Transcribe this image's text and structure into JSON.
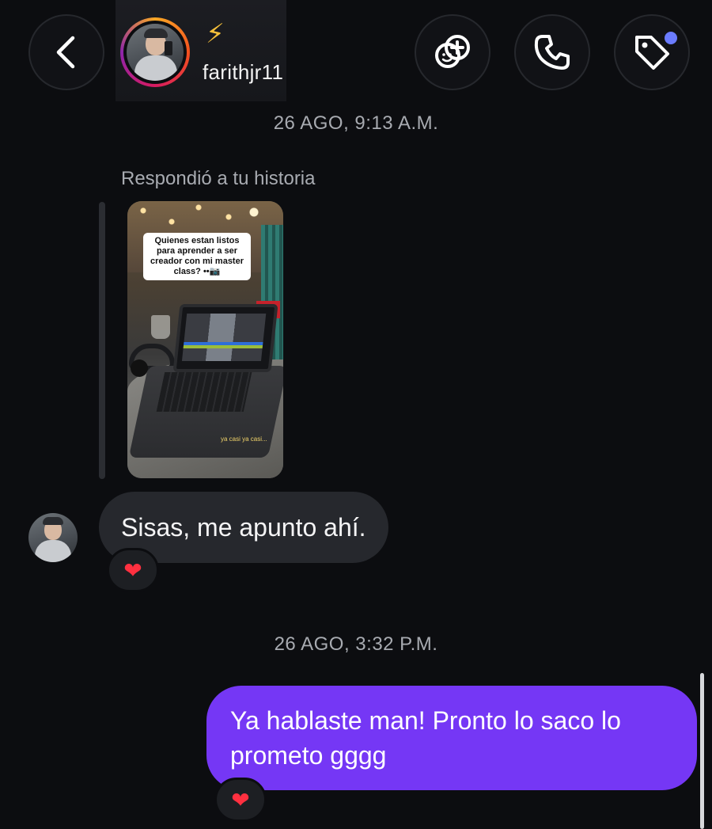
{
  "header": {
    "username": "farithjr11",
    "status_icon": "lightning-bolt-icon",
    "status_glyph": "⚡",
    "buttons": {
      "back": "chevron-left-icon",
      "effects": "sticker-add-icon",
      "call": "phone-icon",
      "tag": "tag-icon"
    },
    "tag_notification_color": "#6b7cff"
  },
  "messages": {
    "timestamp_1": "26 AGO, 9:13 A.M.",
    "story_reply_label": "Respondió a tu historia",
    "story": {
      "caption": "Quienes estan listos para aprender a ser creador con mi master class? ••📷",
      "sign_number": "30",
      "footer_text": "ya casi ya casi..."
    },
    "incoming_text": "Sisas, me apunto ahí.",
    "incoming_reaction": "❤",
    "timestamp_2": "26 AGO, 3:32 P.M.",
    "outgoing_text": "Ya hablaste man! Pronto lo saco lo prometo gggg",
    "outgoing_reaction": "❤"
  },
  "colors": {
    "background": "#0c0d10",
    "incoming_bubble": "#26282d",
    "outgoing_bubble": "#7537f5",
    "heart": "#ff3040"
  }
}
